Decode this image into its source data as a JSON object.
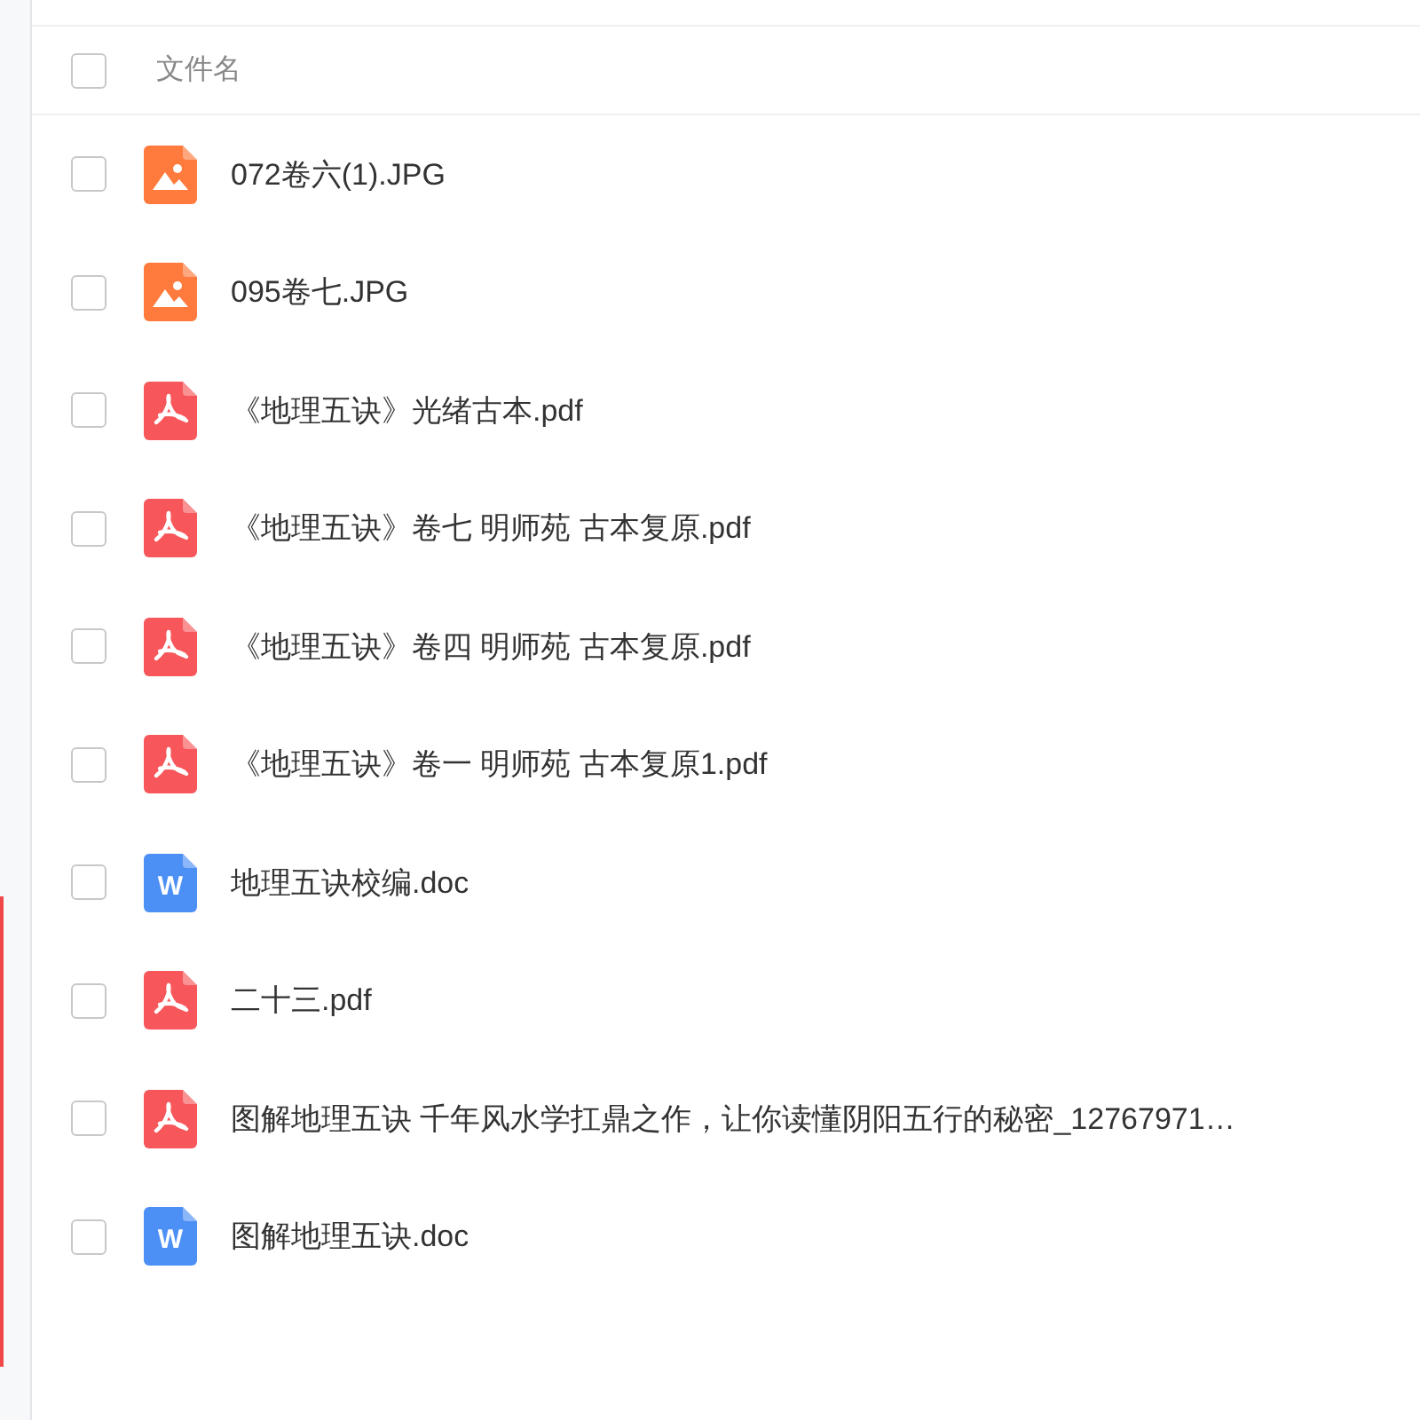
{
  "header": {
    "label": "文件名",
    "checked": false
  },
  "files": [
    {
      "name": "072卷六(1).JPG",
      "kind": "image",
      "checked": false
    },
    {
      "name": "095卷七.JPG",
      "kind": "image",
      "checked": false
    },
    {
      "name": "《地理五诀》光绪古本.pdf",
      "kind": "pdf",
      "checked": false
    },
    {
      "name": "《地理五诀》卷七 明师苑 古本复原.pdf",
      "kind": "pdf",
      "checked": false
    },
    {
      "name": "《地理五诀》卷四 明师苑 古本复原.pdf",
      "kind": "pdf",
      "checked": false
    },
    {
      "name": "《地理五诀》卷一 明师苑 古本复原1.pdf",
      "kind": "pdf",
      "checked": false
    },
    {
      "name": "地理五诀校编.doc",
      "kind": "word",
      "icon_label": "W",
      "checked": false
    },
    {
      "name": "二十三.pdf",
      "kind": "pdf",
      "checked": false
    },
    {
      "name": "图解地理五诀  千年风水学扛鼎之作，让你读懂阴阳五行的秘密_12767971…",
      "kind": "pdf",
      "checked": false
    },
    {
      "name": "图解地理五诀.doc",
      "kind": "word",
      "icon_label": "W",
      "checked": false
    }
  ]
}
